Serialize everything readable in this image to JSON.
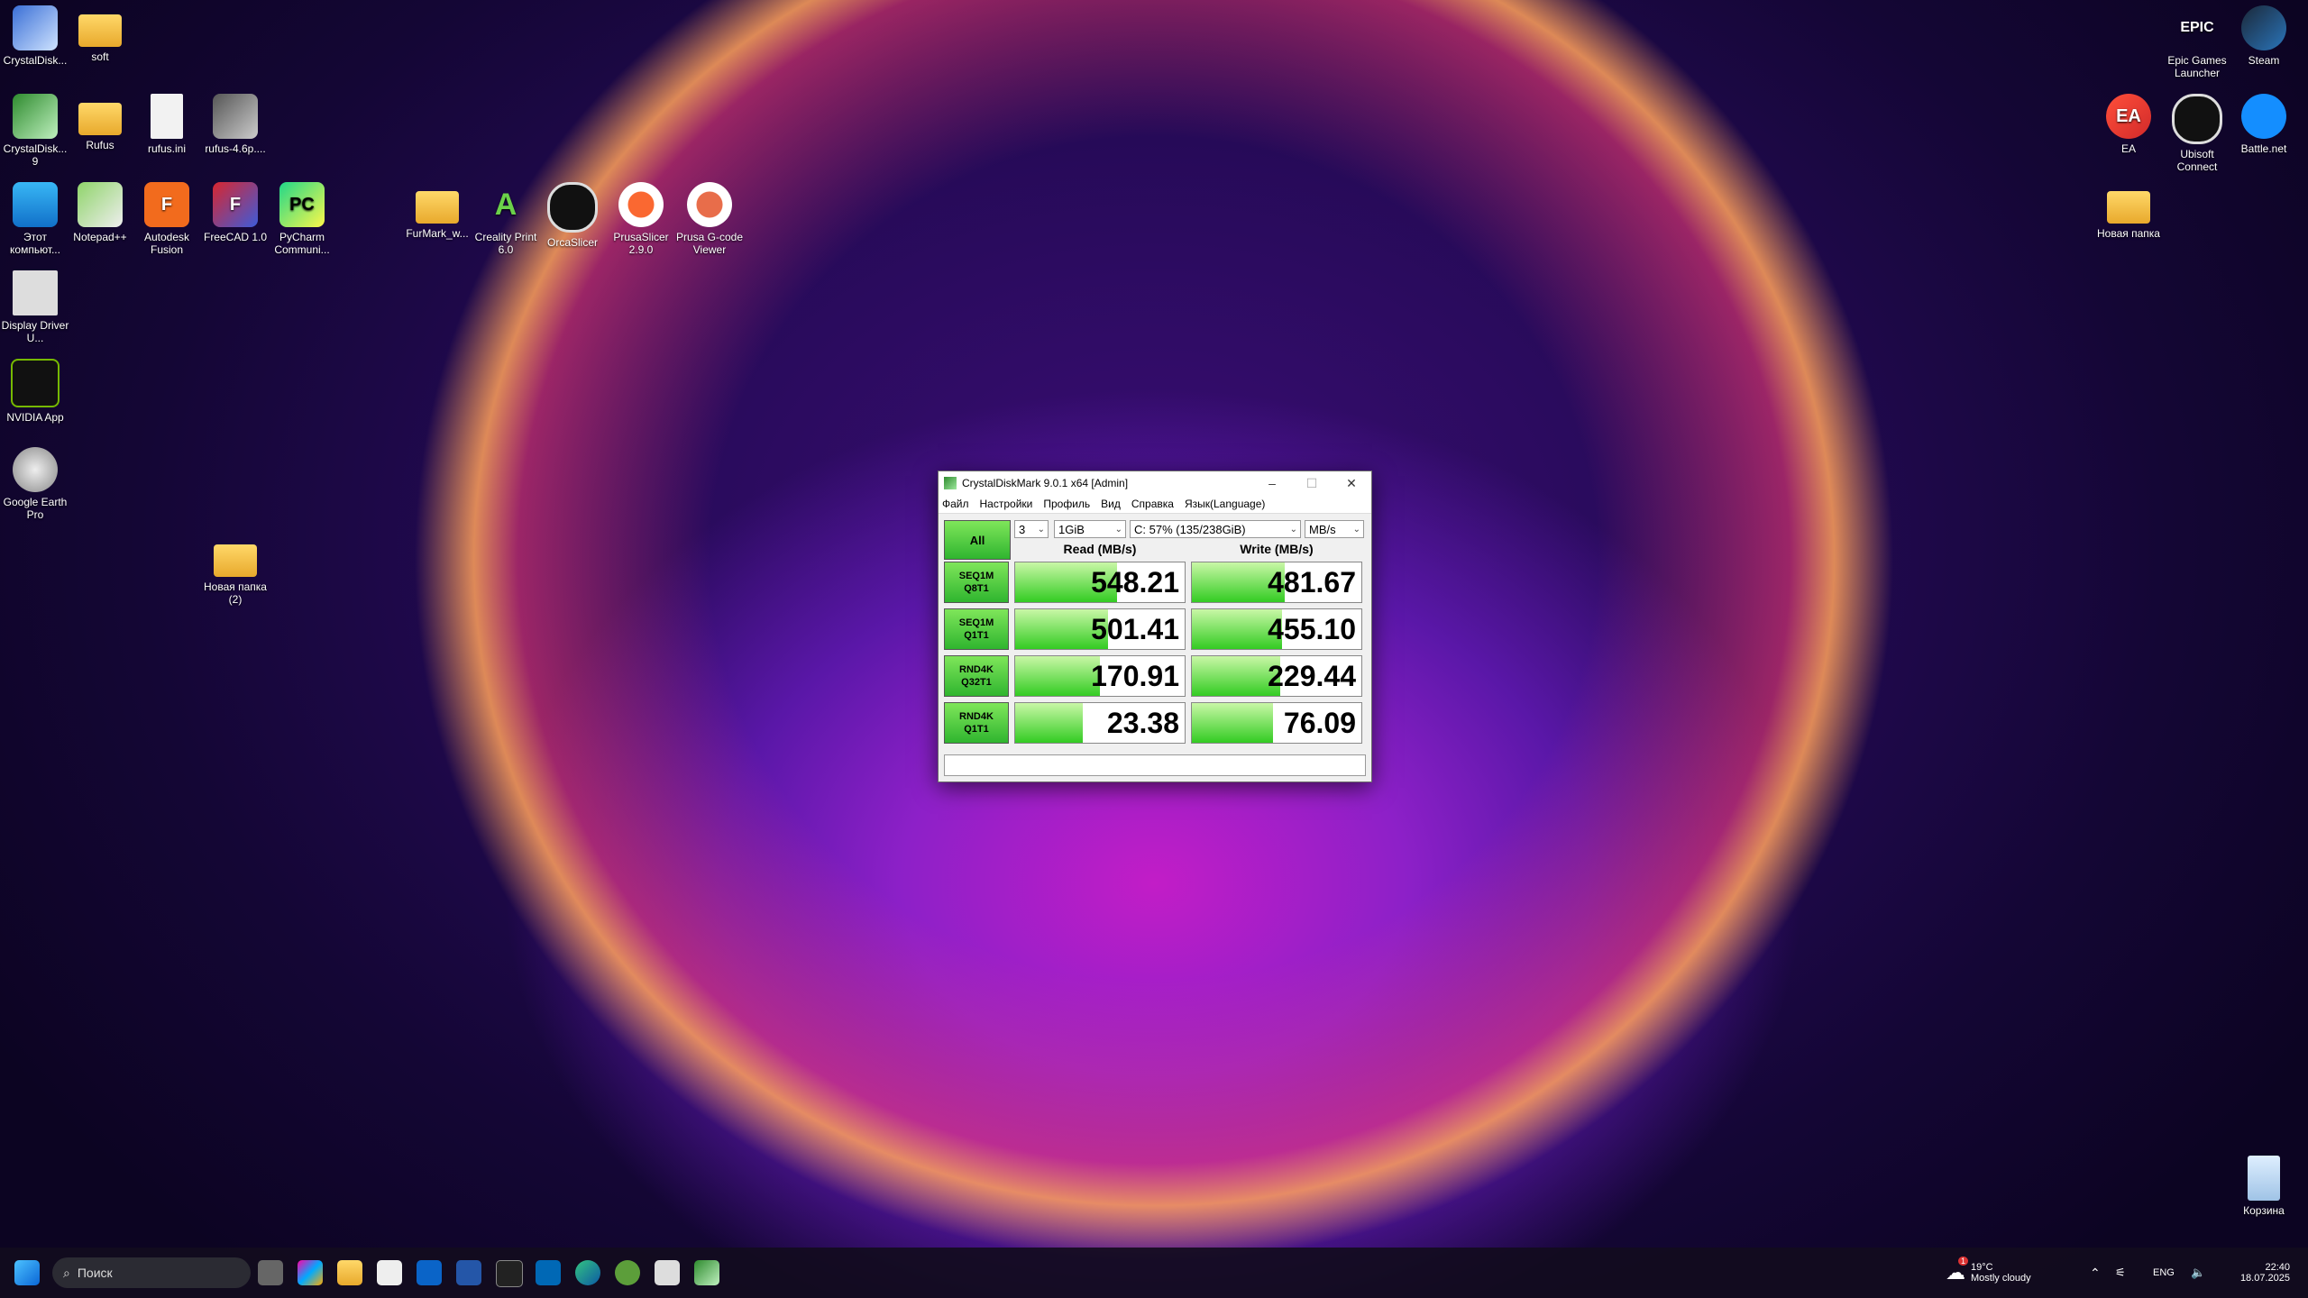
{
  "desktop": {
    "left_icons": [
      {
        "label": "CrystalDisk...",
        "glyph": "disk"
      },
      {
        "label": "soft",
        "glyph": "folder"
      },
      {
        "label": "CrystalDisk... 9",
        "glyph": "disk"
      },
      {
        "label": "Rufus",
        "glyph": "folder"
      },
      {
        "label": "rufus.ini",
        "glyph": "file"
      },
      {
        "label": "rufus-4.6p....",
        "glyph": "usb"
      },
      {
        "label": "Этот компьют...",
        "glyph": "pc"
      },
      {
        "label": "Notepad++",
        "glyph": "notepad"
      },
      {
        "label": "Autodesk Fusion",
        "glyph": "F"
      },
      {
        "label": "FreeCAD 1.0",
        "glyph": "F"
      },
      {
        "label": "PyCharm Communi...",
        "glyph": "PC"
      },
      {
        "label": "FurMark_w...",
        "glyph": "folder"
      },
      {
        "label": "Creality Print 6.0",
        "glyph": "A"
      },
      {
        "label": "OrcaSlicer",
        "glyph": "orca"
      },
      {
        "label": "PrusaSlicer 2.9.0",
        "glyph": "prusa"
      },
      {
        "label": "Prusa G-code Viewer",
        "glyph": "prusa"
      },
      {
        "label": "Display Driver U...",
        "glyph": "ddu"
      },
      {
        "label": "NVIDIA App",
        "glyph": "nvidia"
      },
      {
        "label": "Google Earth Pro",
        "glyph": "earth"
      },
      {
        "label": "Новая папка (2)",
        "glyph": "folder"
      }
    ],
    "right_icons": [
      {
        "label": "Epic Games Launcher",
        "glyph": "EPIC"
      },
      {
        "label": "Steam",
        "glyph": "steam"
      },
      {
        "label": "EA",
        "glyph": "EA"
      },
      {
        "label": "Ubisoft Connect",
        "glyph": "ubi"
      },
      {
        "label": "Battle.net",
        "glyph": "bnet"
      },
      {
        "label": "Новая папка",
        "glyph": "folder"
      },
      {
        "label": "Корзина",
        "glyph": "bin"
      }
    ]
  },
  "window": {
    "title": "CrystalDiskMark 9.0.1 x64 [Admin]",
    "menu": [
      "Файл",
      "Настройки",
      "Профиль",
      "Вид",
      "Справка",
      "Язык(Language)"
    ],
    "all_button": "All",
    "count": "3",
    "size": "1GiB",
    "drive": "C: 57% (135/238GiB)",
    "unit": "MB/s",
    "read_header": "Read (MB/s)",
    "write_header": "Write (MB/s)",
    "rows": [
      {
        "line1": "SEQ1M",
        "line2": "Q8T1",
        "read": "548.21",
        "write": "481.67",
        "read_fill": 0.6,
        "write_fill": 0.55
      },
      {
        "line1": "SEQ1M",
        "line2": "Q1T1",
        "read": "501.41",
        "write": "455.10",
        "read_fill": 0.55,
        "write_fill": 0.53
      },
      {
        "line1": "RND4K",
        "line2": "Q32T1",
        "read": "170.91",
        "write": "229.44",
        "read_fill": 0.5,
        "write_fill": 0.52
      },
      {
        "line1": "RND4K",
        "line2": "Q1T1",
        "read": "23.38",
        "write": "76.09",
        "read_fill": 0.4,
        "write_fill": 0.48
      }
    ],
    "status": ""
  },
  "taskbar": {
    "search_placeholder": "Поиск",
    "weather_temp": "19°C",
    "weather_text": "Mostly cloudy",
    "weather_badge": "1",
    "lang": "ENG",
    "time": "22:40",
    "date": "18.07.2025"
  }
}
